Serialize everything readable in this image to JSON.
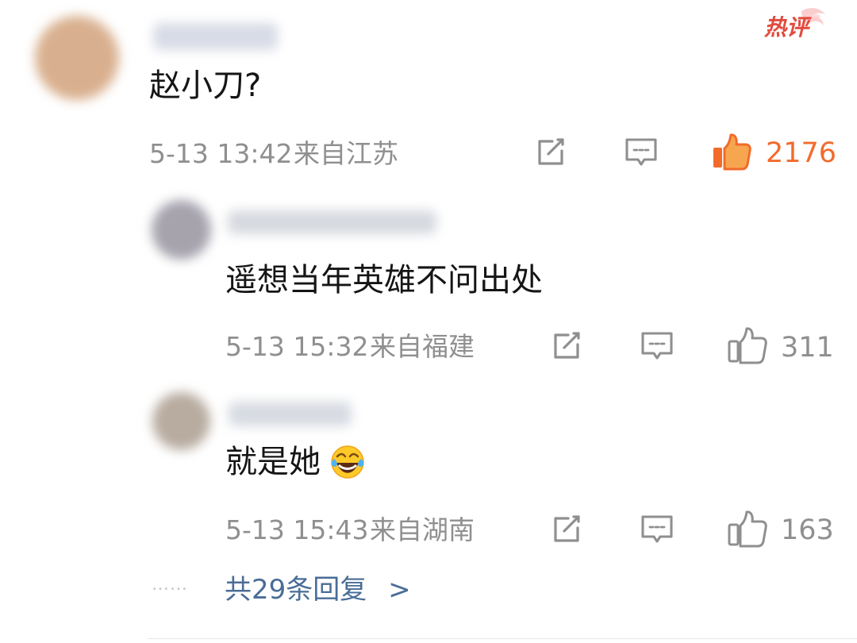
{
  "hot_badge": "热评",
  "main_comment": {
    "text": "赵小刀?",
    "time": "5-13 13:42",
    "location": "来自江苏",
    "likes": "2176",
    "icons": {
      "share": "share-icon",
      "comment": "comment-icon",
      "like": "like-icon"
    }
  },
  "replies": [
    {
      "text": "遥想当年英雄不问出处",
      "time": "5-13 15:32",
      "location": "来自福建",
      "likes": "311"
    },
    {
      "text": "就是她",
      "time": "5-13 15:43",
      "location": "来自湖南",
      "likes": "163",
      "emoji": "laughing-crying-emoji"
    }
  ],
  "more_replies": {
    "dots": "……",
    "label": "共29条回复",
    "chevron": ">"
  },
  "colors": {
    "hot": "#e24a3d",
    "liked": "#f26b2b",
    "meta": "#8f8f8f",
    "link": "#4a6d97"
  }
}
